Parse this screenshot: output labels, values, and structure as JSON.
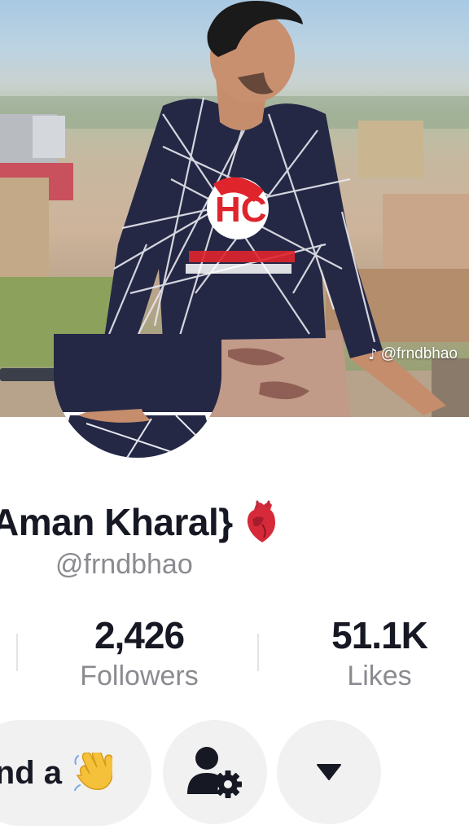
{
  "profile": {
    "display_name": "Aman Kharal}",
    "name_emoji": "anatomical-heart",
    "username": "@frndbhao",
    "watermark": "@frndbhao"
  },
  "stats": {
    "followers": {
      "value": "2,426",
      "label": "Followers"
    },
    "likes": {
      "value": "51.1K",
      "label": "Likes"
    }
  },
  "actions": {
    "wave_button_label": "nd a",
    "wave_emoji": "waving-hand",
    "suggested_friends_icon": "person-gear-icon",
    "more_icon": "triangle-down-icon"
  },
  "colors": {
    "text_primary": "#161823",
    "text_secondary": "#8a8b91",
    "button_bg": "#f1f1f2"
  }
}
